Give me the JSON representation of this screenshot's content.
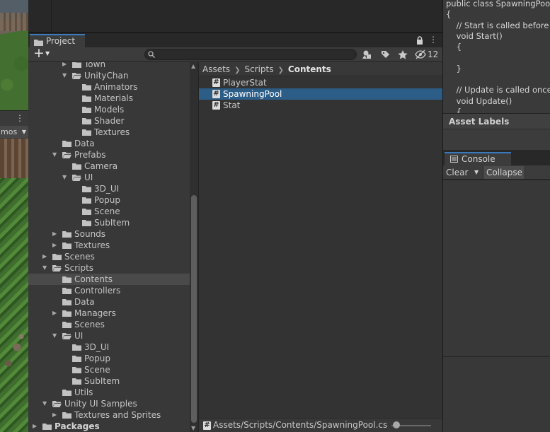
{
  "project": {
    "tab_label": "Project",
    "hidden_count": "12",
    "search": {
      "value": "",
      "placeholder": ""
    }
  },
  "tree": [
    {
      "label": "Town",
      "depth": 3,
      "folder": "closed",
      "arrow": "right",
      "y": -5
    },
    {
      "label": "UnityChan",
      "depth": 3,
      "folder": "open",
      "arrow": "down"
    },
    {
      "label": "Animators",
      "depth": 4,
      "folder": "closed",
      "arrow": ""
    },
    {
      "label": "Materials",
      "depth": 4,
      "folder": "closed",
      "arrow": ""
    },
    {
      "label": "Models",
      "depth": 4,
      "folder": "closed",
      "arrow": ""
    },
    {
      "label": "Shader",
      "depth": 4,
      "folder": "closed",
      "arrow": ""
    },
    {
      "label": "Textures",
      "depth": 4,
      "folder": "closed",
      "arrow": ""
    },
    {
      "label": "Data",
      "depth": 2,
      "folder": "closed",
      "arrow": ""
    },
    {
      "label": "Prefabs",
      "depth": 2,
      "folder": "open",
      "arrow": "down"
    },
    {
      "label": "Camera",
      "depth": 3,
      "folder": "closed",
      "arrow": ""
    },
    {
      "label": "UI",
      "depth": 3,
      "folder": "open",
      "arrow": "down"
    },
    {
      "label": "3D_UI",
      "depth": 4,
      "folder": "closed",
      "arrow": ""
    },
    {
      "label": "Popup",
      "depth": 4,
      "folder": "closed",
      "arrow": ""
    },
    {
      "label": "Scene",
      "depth": 4,
      "folder": "closed",
      "arrow": ""
    },
    {
      "label": "SubItem",
      "depth": 4,
      "folder": "closed",
      "arrow": ""
    },
    {
      "label": "Sounds",
      "depth": 2,
      "folder": "closed",
      "arrow": "right"
    },
    {
      "label": "Textures",
      "depth": 2,
      "folder": "closed",
      "arrow": "right"
    },
    {
      "label": "Scenes",
      "depth": 1,
      "folder": "closed",
      "arrow": "right"
    },
    {
      "label": "Scripts",
      "depth": 1,
      "folder": "open",
      "arrow": "down"
    },
    {
      "label": "Contents",
      "depth": 2,
      "folder": "closed",
      "arrow": "",
      "selected": true
    },
    {
      "label": "Controllers",
      "depth": 2,
      "folder": "closed",
      "arrow": ""
    },
    {
      "label": "Data",
      "depth": 2,
      "folder": "closed",
      "arrow": ""
    },
    {
      "label": "Managers",
      "depth": 2,
      "folder": "closed",
      "arrow": "right"
    },
    {
      "label": "Scenes",
      "depth": 2,
      "folder": "closed",
      "arrow": ""
    },
    {
      "label": "UI",
      "depth": 2,
      "folder": "open",
      "arrow": "down"
    },
    {
      "label": "3D_UI",
      "depth": 3,
      "folder": "closed",
      "arrow": ""
    },
    {
      "label": "Popup",
      "depth": 3,
      "folder": "closed",
      "arrow": ""
    },
    {
      "label": "Scene",
      "depth": 3,
      "folder": "closed",
      "arrow": ""
    },
    {
      "label": "SubItem",
      "depth": 3,
      "folder": "closed",
      "arrow": ""
    },
    {
      "label": "Utils",
      "depth": 2,
      "folder": "closed",
      "arrow": ""
    },
    {
      "label": "Unity UI Samples",
      "depth": 1,
      "folder": "open",
      "arrow": "down"
    },
    {
      "label": "Textures and Sprites",
      "depth": 2,
      "folder": "closed",
      "arrow": "right"
    },
    {
      "label": "Packages",
      "depth": 0,
      "folder": "closed",
      "arrow": "right",
      "bold": true
    }
  ],
  "breadcrumb": [
    "Assets",
    "Scripts",
    "Contents"
  ],
  "files": [
    {
      "name": "PlayerStat",
      "selected": false
    },
    {
      "name": "SpawningPool",
      "selected": true
    },
    {
      "name": "Stat",
      "selected": false
    }
  ],
  "path_bar": "Assets/Scripts/Contents/SpawningPool.cs",
  "scene": {
    "gizmos_label": "mos"
  },
  "code_preview": [
    "public class SpawningPool",
    "{",
    "    // Start is called before the first frame update",
    "    void Start()",
    "    {",
    "",
    "    }",
    "",
    "    // Update is called once per frame",
    "    void Update()",
    "    {"
  ],
  "asset_labels": {
    "title": "Asset Labels"
  },
  "console": {
    "tab_label": "Console",
    "clear_label": "Clear",
    "collapse_label": "Collapse"
  },
  "colors": {
    "selection_blue": "#2c5d87",
    "tab_accent": "#3a79bb",
    "panel_bg": "#383838",
    "folder_icon": "#c2c2c2"
  }
}
